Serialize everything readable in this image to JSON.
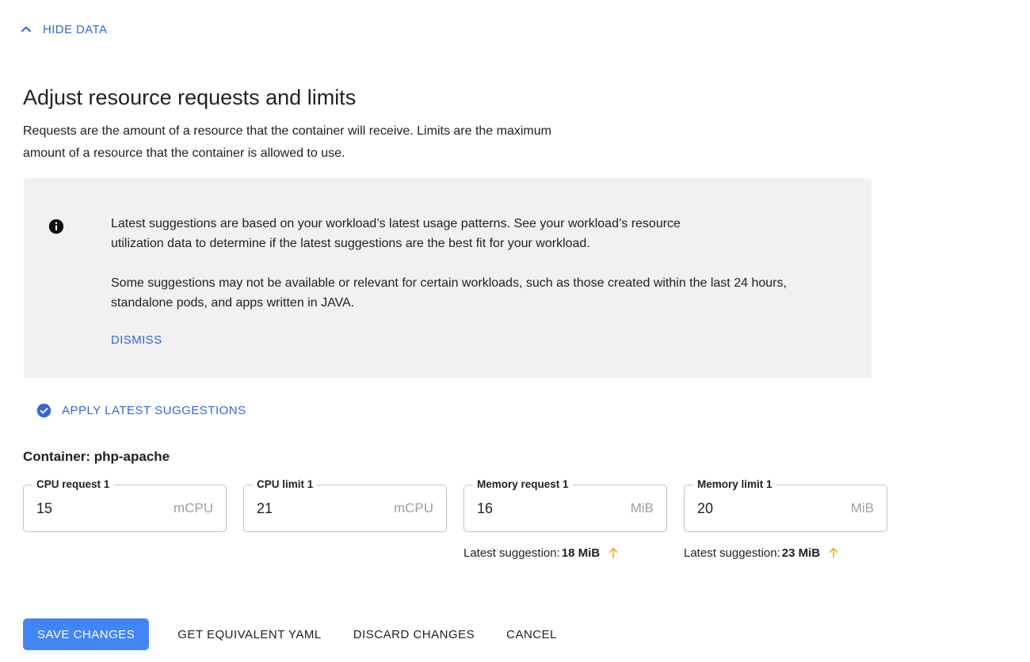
{
  "toggle": {
    "label": "HIDE DATA",
    "icon": "chevron-up-icon",
    "color": "#3367d6"
  },
  "heading": "Adjust resource requests and limits",
  "description": "Requests are the amount of a resource that the container will receive. Limits are the maximum amount of a resource that the container is allowed to use.",
  "banner": {
    "icon": "info-icon",
    "background": "#f1f1f1",
    "paragraph_1": "Latest suggestions are based on your workload’s latest usage patterns. See your workload’s resource utilization data to determine if the latest suggestions are the best fit for your workload.",
    "paragraph_2": "Some suggestions may not be available or relevant for certain workloads, such as those created within the last 24 hours, standalone pods, and apps written in JAVA.",
    "dismiss_label": "DISMISS"
  },
  "apply_suggestions": {
    "icon": "check-circle-icon",
    "label": "APPLY LATEST SUGGESTIONS",
    "color": "#3367d6"
  },
  "container_title": "Container: php-apache",
  "fields": [
    {
      "label": "CPU request 1",
      "value": "15",
      "unit": "mCPU",
      "hint": null,
      "name": "cpu-request-field"
    },
    {
      "label": "CPU limit 1",
      "value": "21",
      "unit": "mCPU",
      "hint": null,
      "name": "cpu-limit-field"
    },
    {
      "label": "Memory request 1",
      "value": "16",
      "unit": "MiB",
      "hint": {
        "prefix": "Latest suggestion: ",
        "value": "18 MiB",
        "trend": "arrow-up-icon",
        "trend_color": "#f9ab00"
      },
      "name": "memory-request-field"
    },
    {
      "label": "Memory limit 1",
      "value": "20",
      "unit": "MiB",
      "hint": {
        "prefix": "Latest suggestion: ",
        "value": "23 MiB",
        "trend": "arrow-up-icon",
        "trend_color": "#f9ab00"
      },
      "name": "memory-limit-field"
    }
  ],
  "actions": {
    "save": "SAVE CHANGES",
    "yaml": "GET EQUIVALENT YAML",
    "discard": "DISCARD CHANGES",
    "cancel": "CANCEL",
    "primary_color": "#4285f4"
  }
}
